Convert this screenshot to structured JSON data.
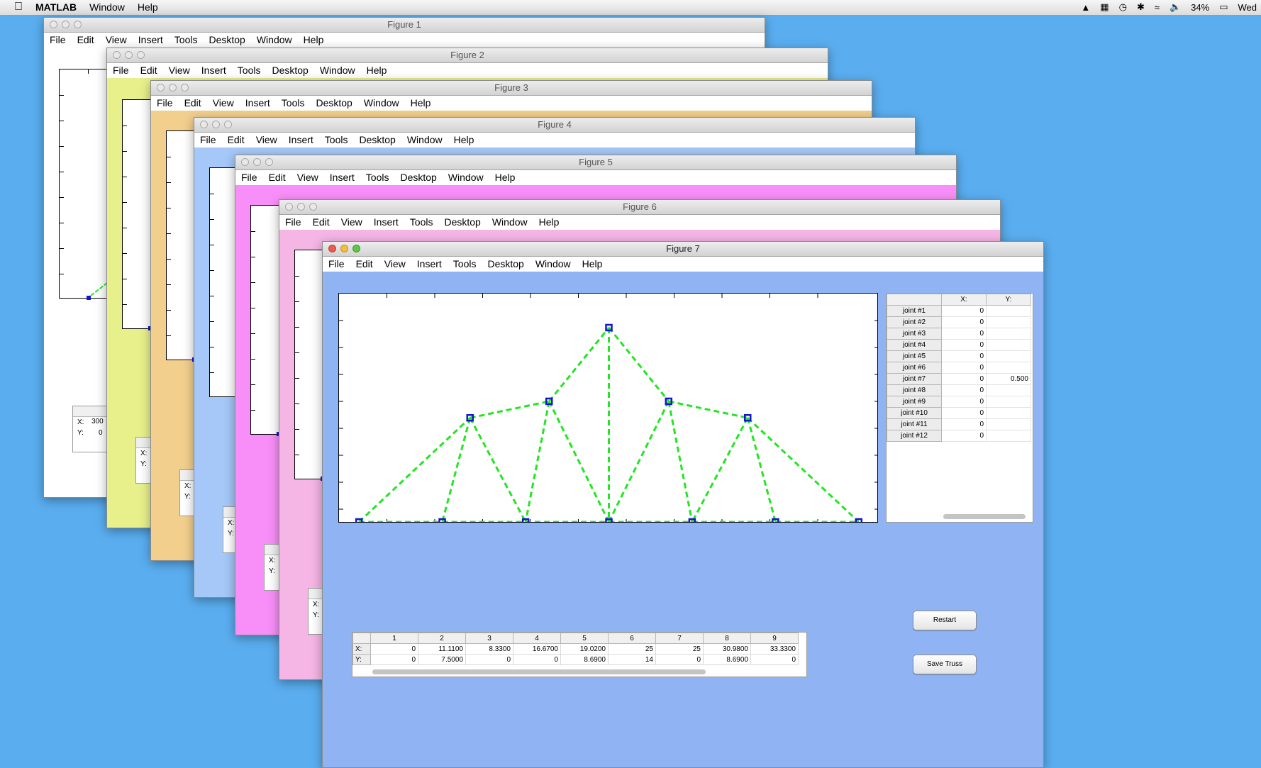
{
  "menubar": {
    "app_name": "MATLAB",
    "menus": [
      "Window",
      "Help"
    ],
    "battery": "34%",
    "day": "Wed"
  },
  "figure_menu": [
    "File",
    "Edit",
    "View",
    "Insert",
    "Tools",
    "Desktop",
    "Window",
    "Help"
  ],
  "figures": [
    {
      "title": "Figure 1",
      "bg": "#ffffff"
    },
    {
      "title": "Figure 2",
      "bg": "#e8f08c"
    },
    {
      "title": "Figure 3",
      "bg": "#f3cf8e"
    },
    {
      "title": "Figure 4",
      "bg": "#a5c8f8"
    },
    {
      "title": "Figure 5",
      "bg": "#f88ff8"
    },
    {
      "title": "Figure 6",
      "bg": "#f5b5e5"
    },
    {
      "title": "Figure 7",
      "bg": "#8fb3f3"
    }
  ],
  "stub_tables": {
    "x_label": "X:",
    "y_label": "Y:",
    "fig1_x_value": "300",
    "fig1_y_value": "0"
  },
  "joints_table": {
    "headers": [
      "X:",
      "Y:"
    ],
    "rows": [
      {
        "label": "joint #1",
        "x": "0",
        "y": ""
      },
      {
        "label": "joint #2",
        "x": "0",
        "y": ""
      },
      {
        "label": "joint #3",
        "x": "0",
        "y": ""
      },
      {
        "label": "joint #4",
        "x": "0",
        "y": ""
      },
      {
        "label": "joint #5",
        "x": "0",
        "y": ""
      },
      {
        "label": "joint #6",
        "x": "0",
        "y": ""
      },
      {
        "label": "joint #7",
        "x": "0",
        "y": "0.500"
      },
      {
        "label": "joint #8",
        "x": "0",
        "y": ""
      },
      {
        "label": "joint #9",
        "x": "0",
        "y": ""
      },
      {
        "label": "joint #10",
        "x": "0",
        "y": ""
      },
      {
        "label": "joint #11",
        "x": "0",
        "y": ""
      },
      {
        "label": "joint #12",
        "x": "0",
        "y": ""
      }
    ]
  },
  "coords_table": {
    "headers": [
      "1",
      "2",
      "3",
      "4",
      "5",
      "6",
      "7",
      "8",
      "9"
    ],
    "x_label": "X:",
    "y_label": "Y:",
    "x": [
      "0",
      "11.1100",
      "8.3300",
      "16.6700",
      "19.0200",
      "25",
      "25",
      "30.9800",
      "33.3300"
    ],
    "y": [
      "0",
      "7.5000",
      "0",
      "0",
      "8.6900",
      "14",
      "0",
      "8.6900",
      "0"
    ]
  },
  "buttons": {
    "restart": "Restart",
    "save": "Save Truss"
  },
  "colors": {
    "member": "#22e622",
    "joint": "#1414d2"
  },
  "truss": {
    "xlim": [
      -2,
      52
    ],
    "ylim": [
      0,
      14
    ],
    "joints": [
      [
        0,
        0
      ],
      [
        8.33,
        0
      ],
      [
        16.67,
        0
      ],
      [
        25,
        0
      ],
      [
        33.33,
        0
      ],
      [
        41.67,
        0
      ],
      [
        50,
        0
      ],
      [
        11.11,
        7.5
      ],
      [
        19.02,
        8.69
      ],
      [
        25,
        14
      ],
      [
        30.98,
        8.69
      ],
      [
        38.89,
        7.5
      ]
    ],
    "members": [
      [
        0,
        1
      ],
      [
        1,
        2
      ],
      [
        2,
        3
      ],
      [
        3,
        4
      ],
      [
        4,
        5
      ],
      [
        5,
        6
      ],
      [
        0,
        7
      ],
      [
        7,
        8
      ],
      [
        8,
        9
      ],
      [
        9,
        10
      ],
      [
        10,
        11
      ],
      [
        11,
        6
      ],
      [
        7,
        1
      ],
      [
        7,
        2
      ],
      [
        8,
        2
      ],
      [
        8,
        3
      ],
      [
        9,
        3
      ],
      [
        10,
        3
      ],
      [
        10,
        4
      ],
      [
        11,
        4
      ],
      [
        11,
        5
      ]
    ]
  }
}
